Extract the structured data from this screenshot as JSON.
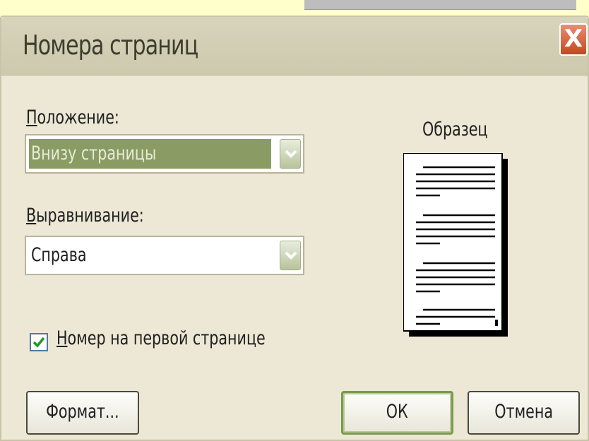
{
  "window": {
    "title": "Номера страниц",
    "close_label": "X"
  },
  "position": {
    "label": "Положение:",
    "selected": "Внизу страницы"
  },
  "alignment": {
    "label": "Выравнивание:",
    "selected": "Справа"
  },
  "first_page_checkbox": {
    "label": "Номер на первой странице",
    "checked": true
  },
  "preview": {
    "title": "Образец"
  },
  "buttons": {
    "format": "Формат...",
    "ok": "ОК",
    "cancel": "Отмена"
  },
  "colors": {
    "dialog_bg": "#ece8d5",
    "selection_bg": "#8a9c64",
    "close_button": "#c4481f",
    "checkmark": "#1f9a1f",
    "default_button_border": "#7a9a4a"
  }
}
